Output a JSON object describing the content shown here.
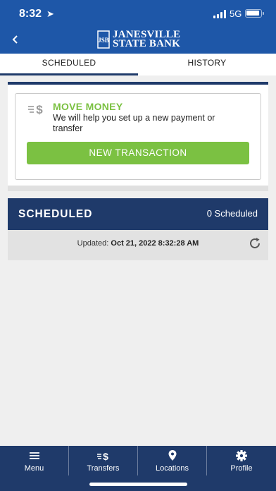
{
  "status_bar": {
    "time": "8:32",
    "network": "5G"
  },
  "header": {
    "logo_line1": "JANESVILLE",
    "logo_line2": "STATE BANK",
    "logo_monogram": "JSB"
  },
  "tabs": [
    {
      "label": "SCHEDULED",
      "active": true
    },
    {
      "label": "HISTORY",
      "active": false
    }
  ],
  "move_money": {
    "icon": "dollar-transfer-icon",
    "title": "MOVE MONEY",
    "description": "We will help you set up a new payment or transfer",
    "button_label": "NEW TRANSACTION"
  },
  "scheduled": {
    "title": "SCHEDULED",
    "count_label": "0 Scheduled",
    "updated_prefix": "Updated:",
    "updated_value": "Oct 21, 2022 8:32:28 AM"
  },
  "bottom_nav": [
    {
      "label": "Menu",
      "icon": "hamburger-icon"
    },
    {
      "label": "Transfers",
      "icon": "transfer-icon"
    },
    {
      "label": "Locations",
      "icon": "location-pin-icon"
    },
    {
      "label": "Profile",
      "icon": "gear-icon"
    }
  ],
  "colors": {
    "header_blue": "#1e57a8",
    "navy": "#1f3a6a",
    "accent_green": "#7bc142"
  }
}
